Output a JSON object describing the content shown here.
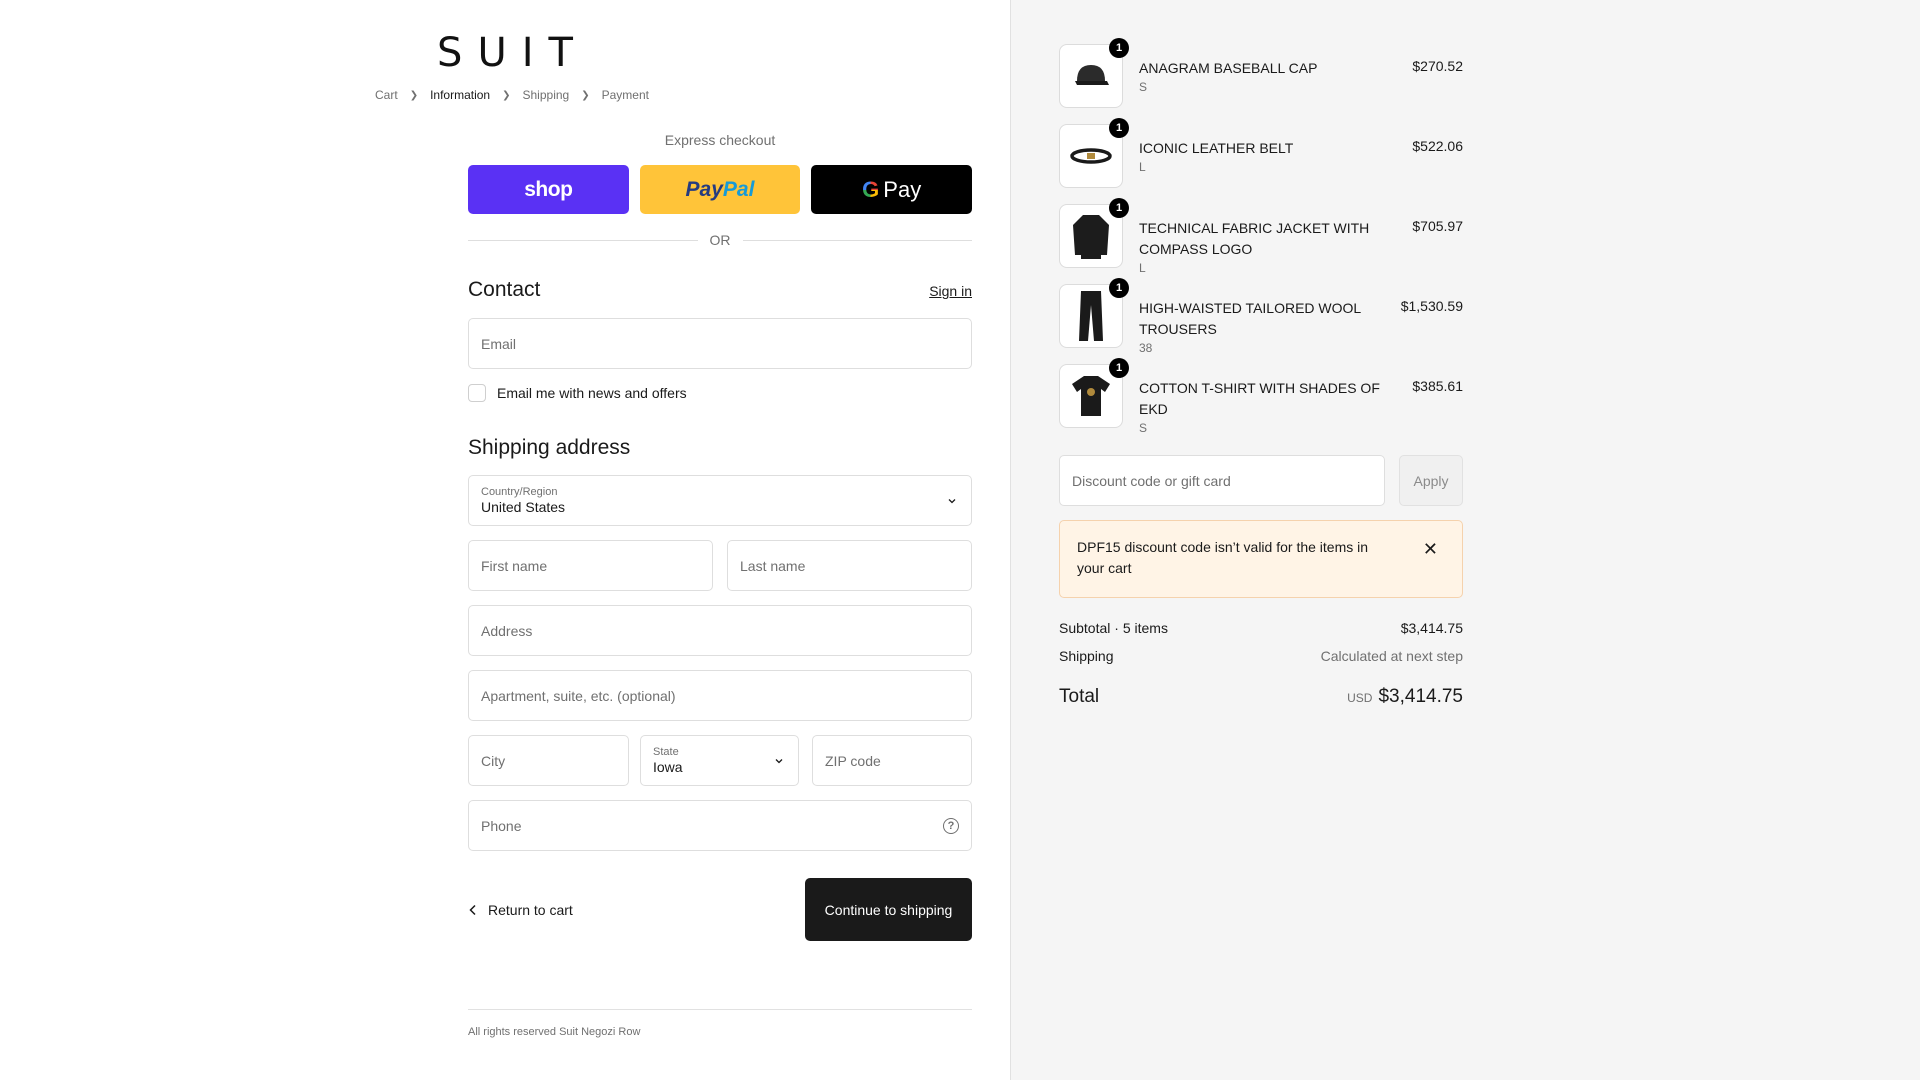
{
  "brand": {
    "logo": "SUIT"
  },
  "breadcrumb": [
    "Cart",
    "Information",
    "Shipping",
    "Payment"
  ],
  "express": {
    "label": "Express checkout",
    "shop": "shop",
    "paypal_a": "Pay",
    "paypal_b": "Pal",
    "gpay_g": "G",
    "gpay_text": "Pay",
    "or": "OR"
  },
  "contact": {
    "title": "Contact",
    "signin": "Sign in",
    "email_placeholder": "Email",
    "newsletter": "Email me with news and offers"
  },
  "shipping": {
    "title": "Shipping address",
    "country_label": "Country/Region",
    "country_value": "United States",
    "first_name": "First name",
    "last_name": "Last name",
    "address": "Address",
    "apartment": "Apartment, suite, etc. (optional)",
    "city": "City",
    "state_label": "State",
    "state_value": "Iowa",
    "zip": "ZIP code",
    "phone": "Phone",
    "help": "?"
  },
  "actions": {
    "back": "Return to cart",
    "continue": "Continue to shipping"
  },
  "footer": "All rights reserved Suit Negozi Row",
  "cart": {
    "items": [
      {
        "name": "ANAGRAM BASEBALL CAP",
        "variant": "S",
        "price": "$270.52",
        "qty": "1",
        "icon": "cap-icon"
      },
      {
        "name": "ICONIC LEATHER BELT",
        "variant": "L",
        "price": "$522.06",
        "qty": "1",
        "icon": "belt-icon"
      },
      {
        "name": "TECHNICAL FABRIC JACKET WITH COMPASS LOGO",
        "variant": "L",
        "price": "$705.97",
        "qty": "1",
        "icon": "jacket-icon"
      },
      {
        "name": "HIGH-WAISTED TAILORED WOOL TROUSERS",
        "variant": "38",
        "price": "$1,530.59",
        "qty": "1",
        "icon": "trousers-icon"
      },
      {
        "name": "COTTON T-SHIRT WITH SHADES OF EKD",
        "variant": "S",
        "price": "$385.61",
        "qty": "1",
        "icon": "tshirt-icon"
      }
    ],
    "discount_placeholder": "Discount code or gift card",
    "apply": "Apply",
    "alert": "DPF15 discount code isn’t valid for the items in your cart",
    "subtotal_label": "Subtotal · 5 items",
    "subtotal_value": "$3,414.75",
    "shipping_label": "Shipping",
    "shipping_value": "Calculated at next step",
    "total_label": "Total",
    "total_currency": "USD",
    "total_value": "$3,414.75"
  },
  "colors": {
    "shop": "#5a31f4",
    "paypal": "#ffc439",
    "gpay": "#000000",
    "alert_bg": "#fff4e6",
    "primary_button": "#1a1a1a"
  }
}
